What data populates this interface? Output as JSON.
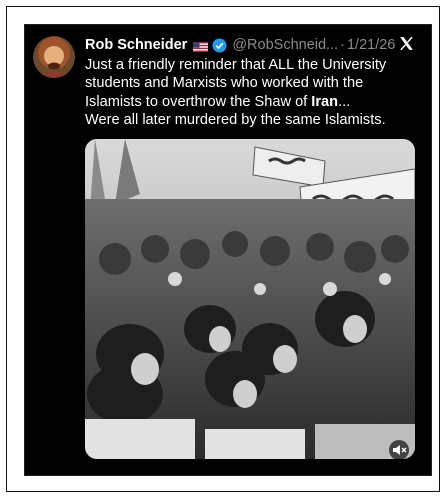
{
  "tweet": {
    "author_name": "Rob Schneider",
    "flag_icon": "us-flag-icon",
    "verified_icon": "verified-badge-icon",
    "handle": "@RobSchneid...",
    "separator": "·",
    "date": "1/21/26",
    "platform_icon": "x-logo-icon",
    "text_lines": {
      "l1": "Just a friendly reminder that ALL the University",
      "l2": "students and Marxists who worked with the",
      "l3_pre": "Islamists to overthrow the Shaw of ",
      "l3_bold": "Iran",
      "l3_post": "...",
      "l4": "Were all later murdered by the same Islamists."
    },
    "media": {
      "type": "black-and-white photo of a large crowd of protesters with raised fists and banners",
      "mute_icon": "muted-speaker-icon"
    }
  },
  "colors": {
    "background": "#000000",
    "text": "#ffffff",
    "secondary_text": "#8b8b8b",
    "verified_blue": "#1d9bf0"
  }
}
